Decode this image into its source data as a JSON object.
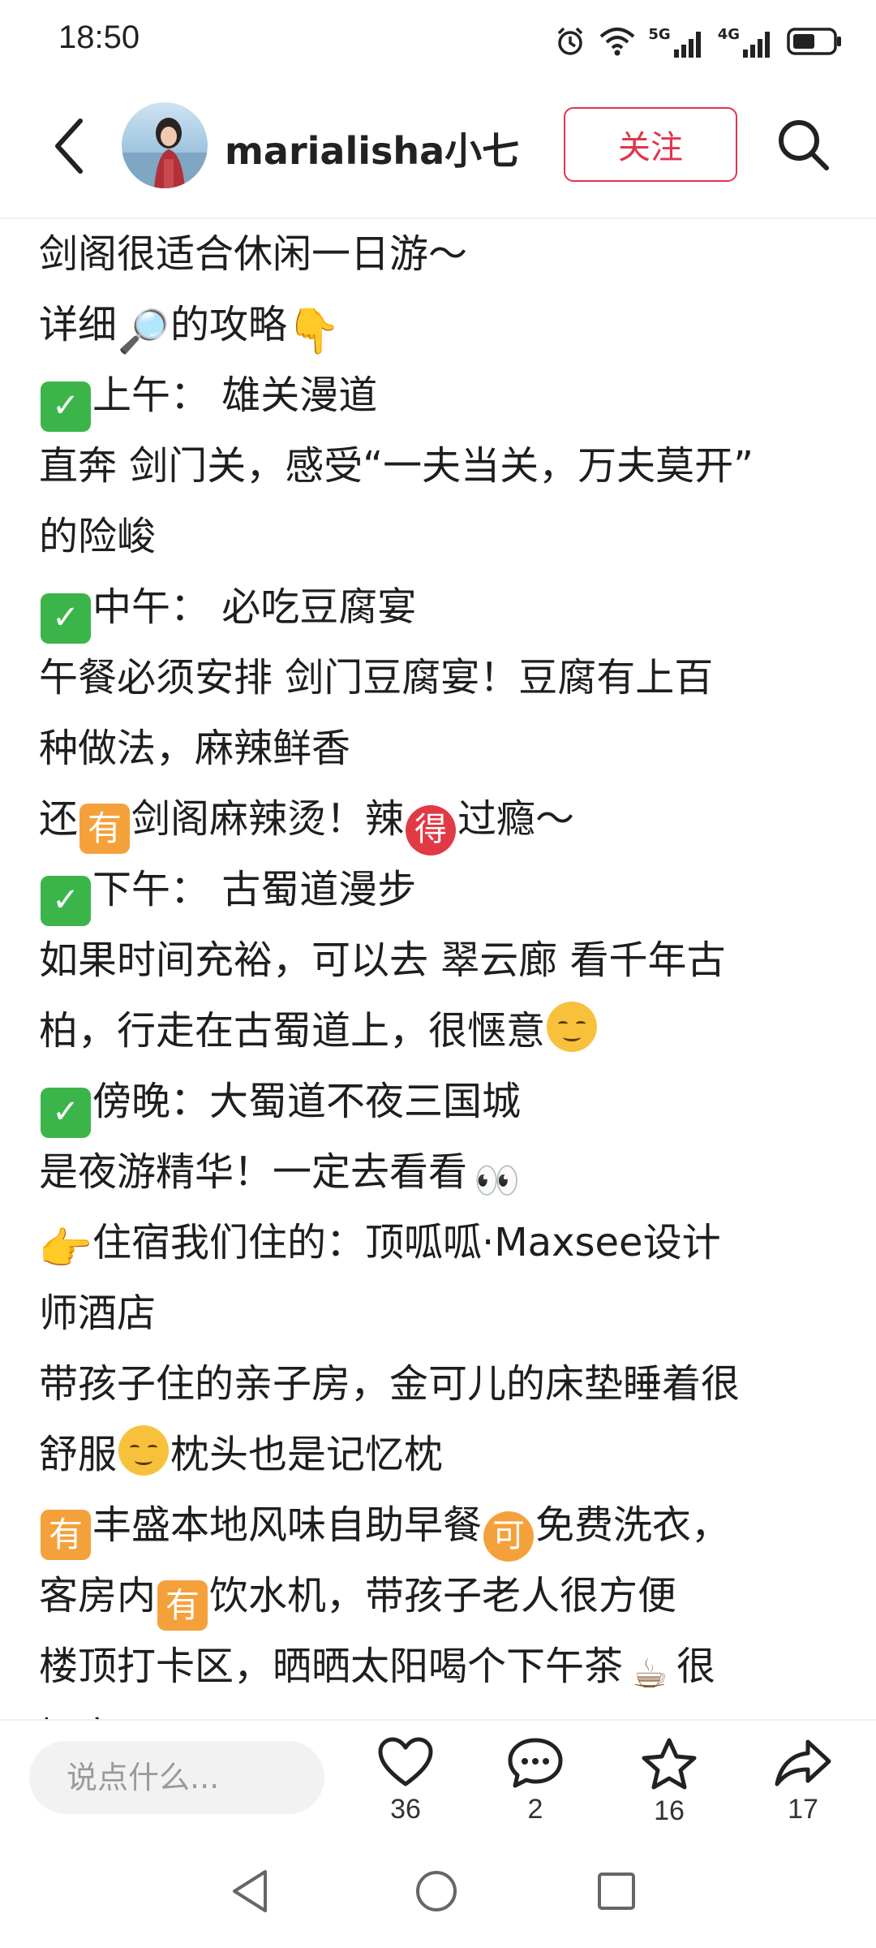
{
  "status_bar": {
    "time": "18:50",
    "network_5g": "5G",
    "network_4g": "4G",
    "icons": [
      "alarm-icon",
      "wifi-icon",
      "signal-icon",
      "battery-icon"
    ]
  },
  "header": {
    "username": "marialisha小七",
    "follow_label": "关注",
    "icons": [
      "back-icon",
      "search-icon"
    ]
  },
  "content": {
    "lines": [
      "剑阁很适合休闲一日游～",
      "的攻略",
      "上午： 雄关漫道",
      "直奔 剑门关，感受“一夫当关，万夫莫开”",
      "的险峻",
      "中午：  必吃豆腐宴",
      "午餐必须安排 剑门豆腐宴！豆腐有上百",
      "种做法，麻辣鲜香",
      "剑阁麻辣烫！辣",
      "过瘾～",
      "下午： 古蜀道漫步",
      "如果时间充裕，可以去 翠云廊 看千年古",
      "柏，行走在古蜀道上，很惬意",
      "傍晚：大蜀道不夜三国城",
      "是夜游精华！一定去看看",
      "住宿我们住的：顶呱呱·Maxsee设计",
      "师酒店",
      "带孩子住的亲子房，金可儿的床垫睡着很",
      "舒服",
      "枕头也是记忆枕",
      "丰盛本地风味自助早餐",
      "免费洗衣，",
      "客房内",
      "饮水机，带孩子老人很方便",
      "楼顶打卡区，晒晒太阳喝个下午茶",
      "很",
      "惬意"
    ],
    "prefixes": {
      "xiang_xi": "详细",
      "hai": "还"
    },
    "emoji": {
      "you": "有",
      "de": "得",
      "ke": "可"
    }
  },
  "bottom_bar": {
    "comment_placeholder": "说点什么...",
    "like_count": "36",
    "comment_count": "2",
    "star_count": "16",
    "share_count": "17"
  },
  "colors": {
    "follow_accent": "#e0344c",
    "check_green": "#3bb54a",
    "badge_orange": "#f5a13b"
  }
}
